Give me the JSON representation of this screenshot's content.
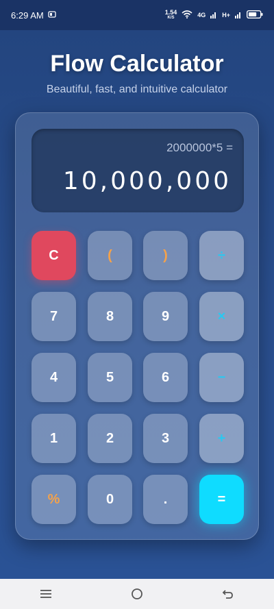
{
  "status_bar": {
    "time": "6:29 AM",
    "net_speed_value": "1.54",
    "net_speed_unit": "K/S",
    "network_label_1": "4G",
    "network_label_2": "H+",
    "battery_level": 0.7
  },
  "header": {
    "title": "Flow Calculator",
    "subtitle": "Beautiful, fast, and intuitive calculator"
  },
  "display": {
    "expression": "2000000*5 =",
    "result": "10,000,000"
  },
  "keys": {
    "clear": "C",
    "open_paren": "(",
    "close_paren": ")",
    "divide": "÷",
    "seven": "7",
    "eight": "8",
    "nine": "9",
    "multiply": "×",
    "four": "4",
    "five": "5",
    "six": "6",
    "subtract": "−",
    "one": "1",
    "two": "2",
    "three": "3",
    "add": "+",
    "percent": "%",
    "zero": "0",
    "decimal": ".",
    "equals": "="
  },
  "colors": {
    "accent": "#0fdcff",
    "clear": "#e0485e",
    "paren": "#f5a24a",
    "operator": "#2ac8f0"
  }
}
